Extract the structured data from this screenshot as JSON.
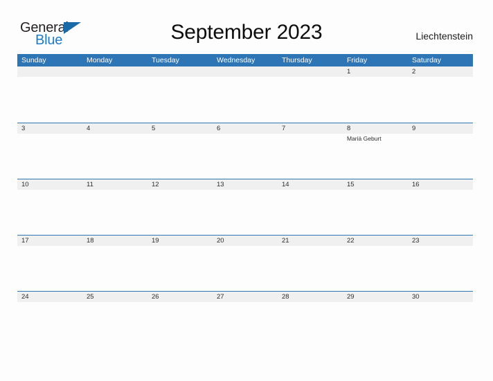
{
  "brand": {
    "name_part1": "General",
    "name_part2": "Blue",
    "flag_icon": "triangle-flag-icon",
    "primary_color": "#2E75B6",
    "logo_blue": "#1C7AC9",
    "logo_dark": "#231F20"
  },
  "header": {
    "title": "September 2023",
    "country": "Liechtenstein"
  },
  "calendar": {
    "header_band_color": "#2E75B6",
    "date_strip_color": "#F0F0F0",
    "separator_color": "#2E75B6",
    "weekdays": [
      "Sunday",
      "Monday",
      "Tuesday",
      "Wednesday",
      "Thursday",
      "Friday",
      "Saturday"
    ],
    "weeks": [
      {
        "days": [
          {
            "date": "",
            "event": ""
          },
          {
            "date": "",
            "event": ""
          },
          {
            "date": "",
            "event": ""
          },
          {
            "date": "",
            "event": ""
          },
          {
            "date": "",
            "event": ""
          },
          {
            "date": "1",
            "event": ""
          },
          {
            "date": "2",
            "event": ""
          }
        ]
      },
      {
        "days": [
          {
            "date": "3",
            "event": ""
          },
          {
            "date": "4",
            "event": ""
          },
          {
            "date": "5",
            "event": ""
          },
          {
            "date": "6",
            "event": ""
          },
          {
            "date": "7",
            "event": ""
          },
          {
            "date": "8",
            "event": "Mariä Geburt"
          },
          {
            "date": "9",
            "event": ""
          }
        ]
      },
      {
        "days": [
          {
            "date": "10",
            "event": ""
          },
          {
            "date": "11",
            "event": ""
          },
          {
            "date": "12",
            "event": ""
          },
          {
            "date": "13",
            "event": ""
          },
          {
            "date": "14",
            "event": ""
          },
          {
            "date": "15",
            "event": ""
          },
          {
            "date": "16",
            "event": ""
          }
        ]
      },
      {
        "days": [
          {
            "date": "17",
            "event": ""
          },
          {
            "date": "18",
            "event": ""
          },
          {
            "date": "19",
            "event": ""
          },
          {
            "date": "20",
            "event": ""
          },
          {
            "date": "21",
            "event": ""
          },
          {
            "date": "22",
            "event": ""
          },
          {
            "date": "23",
            "event": ""
          }
        ]
      },
      {
        "days": [
          {
            "date": "24",
            "event": ""
          },
          {
            "date": "25",
            "event": ""
          },
          {
            "date": "26",
            "event": ""
          },
          {
            "date": "27",
            "event": ""
          },
          {
            "date": "28",
            "event": ""
          },
          {
            "date": "29",
            "event": ""
          },
          {
            "date": "30",
            "event": ""
          }
        ]
      }
    ]
  }
}
